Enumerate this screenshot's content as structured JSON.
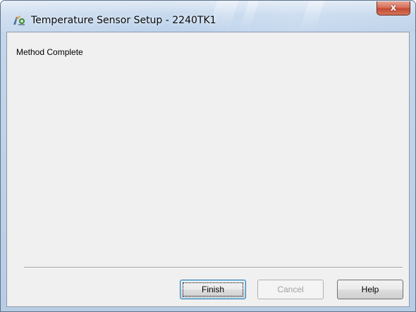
{
  "window": {
    "title": "Temperature Sensor Setup - 2240TK1",
    "icon": "sensor-setup-app-icon",
    "close_glyph": "x",
    "accent_close": "#c74a33",
    "frame_color": "#bcd2eb"
  },
  "content": {
    "status_text": "Method Complete"
  },
  "buttons": {
    "finish_label": "Finish",
    "cancel_label": "Cancel",
    "help_label": "Help",
    "cancel_enabled": false
  }
}
